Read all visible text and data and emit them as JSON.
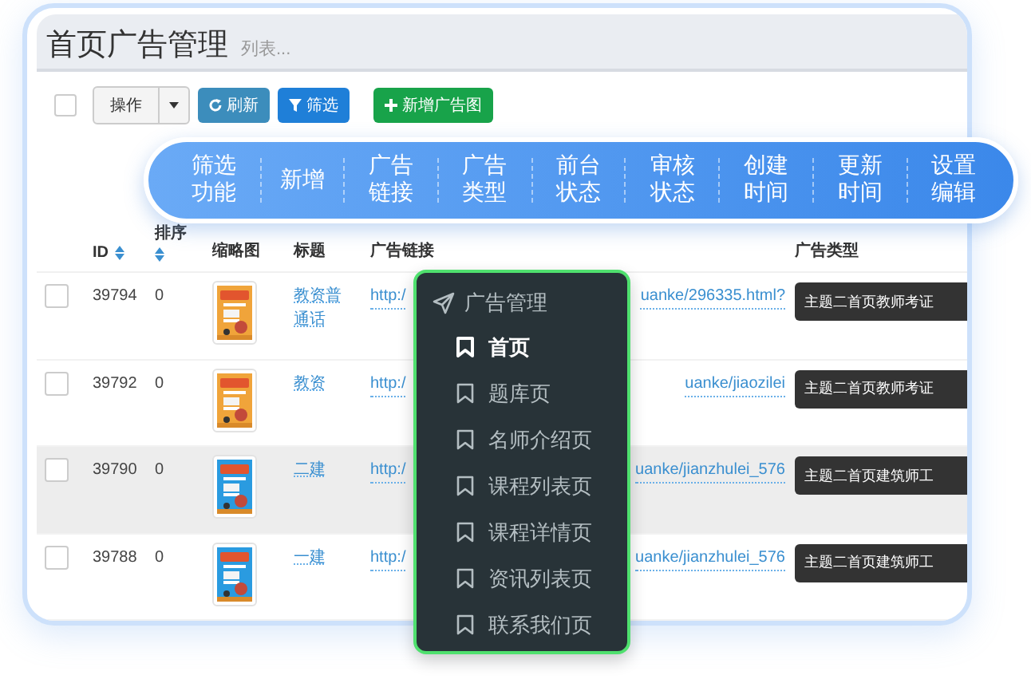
{
  "page": {
    "title": "首页广告管理",
    "subtitle": "列表..."
  },
  "toolbar": {
    "select_all": {
      "checked": false
    },
    "action_label": "操作",
    "buttons": [
      {
        "kind": "refresh",
        "label": "刷新"
      },
      {
        "kind": "filter",
        "label": "筛选"
      },
      {
        "kind": "add",
        "label": "新增广告图"
      }
    ]
  },
  "banner": {
    "items": [
      "筛选功能",
      "新增",
      "广告链接",
      "广告类型",
      "前台状态",
      "审核状态",
      "创建时间",
      "更新时间",
      "设置编辑"
    ]
  },
  "table": {
    "columns": [
      {
        "label": "ID",
        "sortable": true
      },
      {
        "label": "排序",
        "sortable": true
      },
      {
        "label": "缩略图",
        "sortable": false
      },
      {
        "label": "标题",
        "sortable": false
      },
      {
        "label": "广告链接",
        "sortable": false
      },
      {
        "label": "广告类型",
        "sortable": false
      }
    ],
    "rows": [
      {
        "id": "39794",
        "order": "0",
        "title": "教资普通话",
        "link_start": "http:/",
        "link_end": "uanke/296335.html?",
        "type": "主题二首页教师考证",
        "highlighted": false,
        "checked": false
      },
      {
        "id": "39792",
        "order": "0",
        "title": "教资",
        "link_start": "http:/",
        "link_end": "uanke/jiaozilei",
        "type": "主题二首页教师考证",
        "highlighted": false,
        "checked": false
      },
      {
        "id": "39790",
        "order": "0",
        "title": "二建",
        "link_start": "http:/",
        "link_end": "uanke/jianzhulei_576",
        "type": "主题二首页建筑师工",
        "highlighted": true,
        "checked": false
      },
      {
        "id": "39788",
        "order": "0",
        "title": "一建",
        "link_start": "http:/",
        "link_end": "uanke/jianzhulei_576",
        "type": "主题二首页建筑师工",
        "highlighted": false,
        "checked": false
      }
    ]
  },
  "menu": {
    "title": "广告管理",
    "items": [
      {
        "label": "首页",
        "selected": true
      },
      {
        "label": "题库页",
        "selected": false
      },
      {
        "label": "名师介绍页",
        "selected": false
      },
      {
        "label": "课程列表页",
        "selected": false
      },
      {
        "label": "课程详情页",
        "selected": false
      },
      {
        "label": "资讯列表页",
        "selected": false
      },
      {
        "label": "联系我们页",
        "selected": false
      }
    ]
  }
}
